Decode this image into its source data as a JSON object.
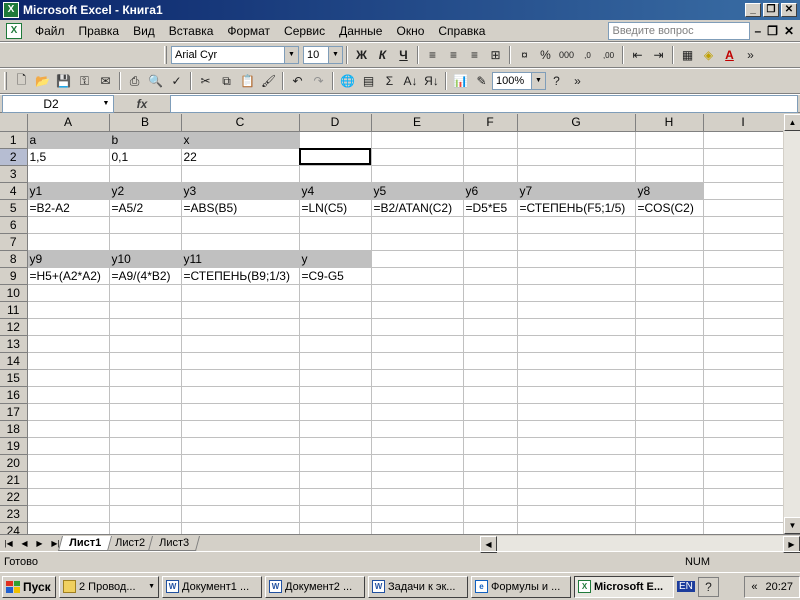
{
  "window": {
    "title": "Microsoft Excel - Книга1"
  },
  "menu": {
    "items": [
      "Файл",
      "Правка",
      "Вид",
      "Вставка",
      "Формат",
      "Сервис",
      "Данные",
      "Окно",
      "Справка"
    ],
    "help_placeholder": "Введите вопрос"
  },
  "format_toolbar": {
    "font": "Arial Cyr",
    "size": "10",
    "bold": "Ж",
    "italic": "К",
    "underline": "Ч"
  },
  "standard_toolbar": {
    "zoom": "100%"
  },
  "formula_bar": {
    "name_box": "D2",
    "fx": "fx",
    "formula": ""
  },
  "sheet": {
    "columns": [
      "A",
      "B",
      "C",
      "D",
      "E",
      "F",
      "G",
      "H",
      "I"
    ],
    "rows": [
      [
        "a",
        "b",
        "x",
        "",
        "",
        "",
        "",
        "",
        ""
      ],
      [
        "1,5",
        "0,1",
        "22",
        "",
        "",
        "",
        "",
        "",
        ""
      ],
      [
        "",
        "",
        "",
        "",
        "",
        "",
        "",
        "",
        ""
      ],
      [
        "y1",
        "y2",
        "y3",
        "y4",
        "y5",
        "y6",
        "y7",
        "y8",
        ""
      ],
      [
        "=B2-A2",
        "=A5/2",
        "=ABS(B5)",
        "=LN(C5)",
        "=B2/ATAN(C2)",
        "=D5*E5",
        "=СТЕПЕНЬ(F5;1/5)",
        "=COS(C2)",
        ""
      ],
      [
        "",
        "",
        "",
        "",
        "",
        "",
        "",
        "",
        ""
      ],
      [
        "",
        "",
        "",
        "",
        "",
        "",
        "",
        "",
        ""
      ],
      [
        "y9",
        "y10",
        "y11",
        "y",
        "",
        "",
        "",
        "",
        ""
      ],
      [
        "=H5+(A2*A2)",
        "=A9/(4*B2)",
        "=СТЕПЕНЬ(B9;1/3)",
        "=C9-G5",
        "",
        "",
        "",
        "",
        ""
      ]
    ],
    "row_count": 24,
    "active_cell": "D2"
  },
  "tabs": [
    "Лист1",
    "Лист2",
    "Лист3"
  ],
  "status": {
    "text": "Готово",
    "num": "NUM"
  },
  "taskbar": {
    "start": "Пуск",
    "items": [
      {
        "label": "2 Провод...",
        "icon": "folder-icon"
      },
      {
        "label": "Документ1 ...",
        "icon": "word-icon"
      },
      {
        "label": "Документ2 ...",
        "icon": "word-icon"
      },
      {
        "label": "Задачи к эк...",
        "icon": "word-icon"
      },
      {
        "label": "Формулы и ...",
        "icon": "ie-icon"
      },
      {
        "label": "Microsoft E...",
        "icon": "excel-icon",
        "active": true
      }
    ],
    "lang": "EN",
    "time": "20:27"
  }
}
